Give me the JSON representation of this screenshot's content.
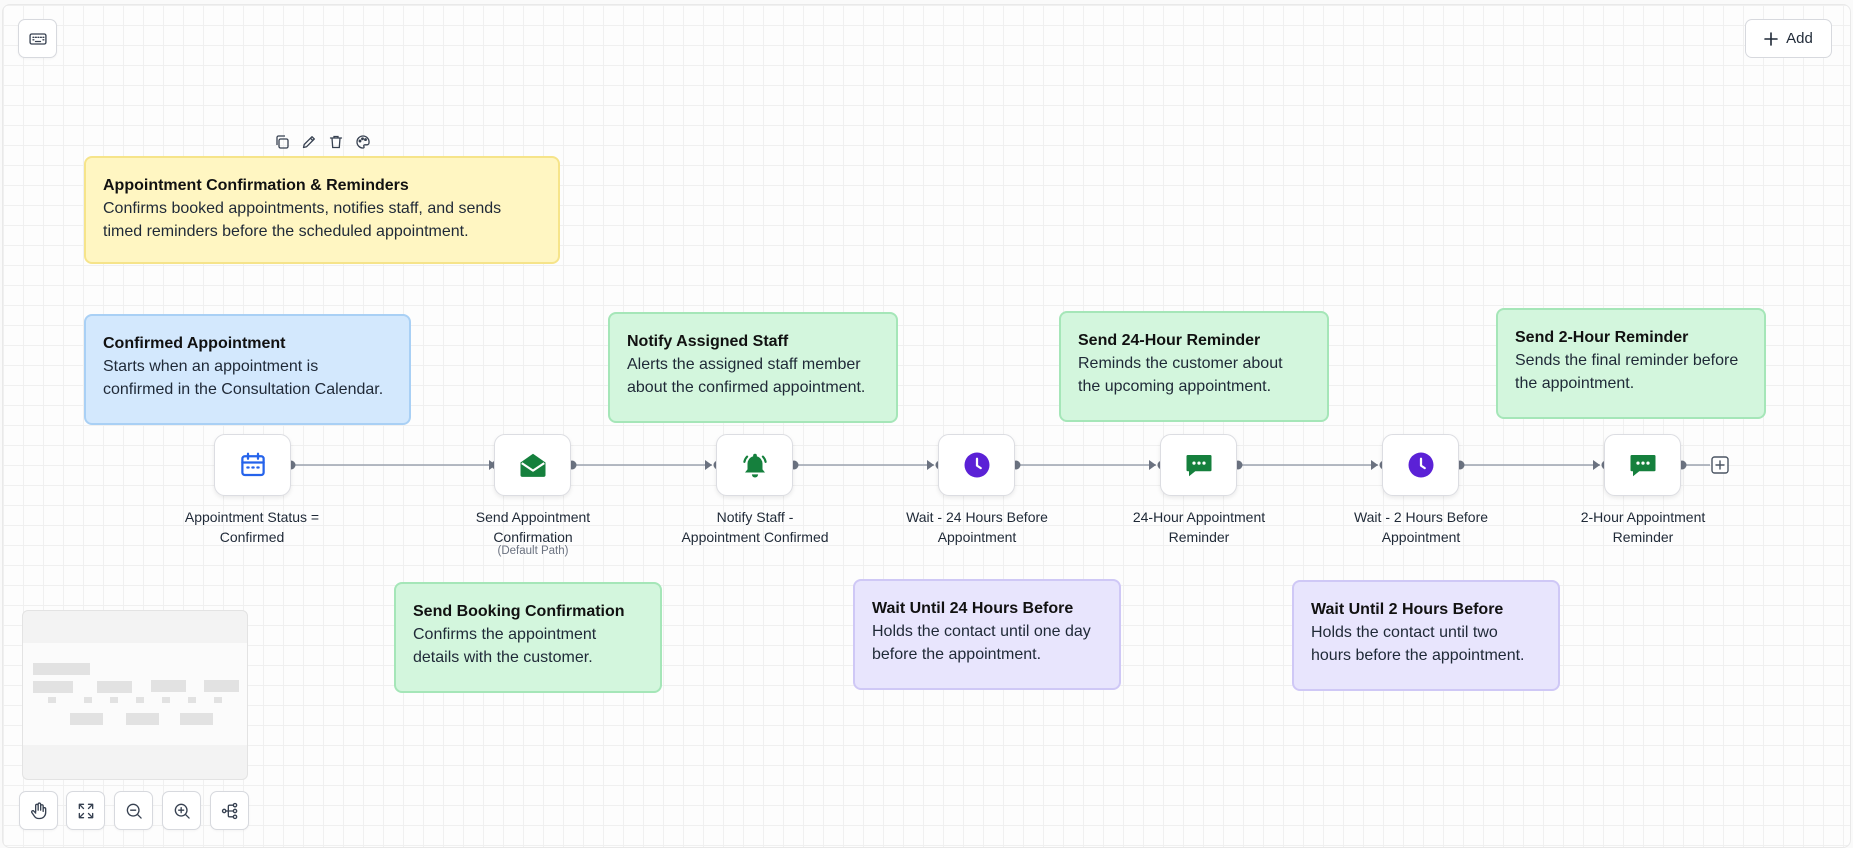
{
  "toolbar": {
    "add_label": "Add"
  },
  "notes": {
    "workflow": {
      "title": "Appointment Confirmation & Reminders",
      "line1": "Confirms booked appointments, notifies staff, and sends",
      "line2": "timed reminders before the scheduled appointment."
    },
    "trigger": {
      "title": "Confirmed Appointment",
      "line1": "Starts when an appointment is",
      "line2": "confirmed in the Consultation Calendar."
    },
    "booking": {
      "title": "Send Booking Confirmation",
      "line1": "Confirms the appointment",
      "line2": "details with the customer."
    },
    "notify": {
      "title": "Notify Assigned Staff",
      "line1": "Alerts the assigned staff member",
      "line2": "about the confirmed appointment."
    },
    "wait24": {
      "title": "Wait Until 24 Hours Before",
      "line1": "Holds the contact until one day",
      "line2": "before the appointment."
    },
    "reminder24": {
      "title": "Send 24-Hour Reminder",
      "line1": "Reminds the customer about",
      "line2": "the upcoming appointment."
    },
    "wait2": {
      "title": "Wait Until 2 Hours Before",
      "line1": "Holds the contact until two",
      "line2": "hours before the appointment."
    },
    "reminder2": {
      "title": "Send 2-Hour Reminder",
      "line1": "Sends the final reminder before",
      "line2": "the appointment."
    }
  },
  "nodes": [
    {
      "line1": "Appointment Status =",
      "line2": "Confirmed",
      "icon": "calendar-icon",
      "color": "#2563eb"
    },
    {
      "line1": "Send Appointment",
      "line2": "Confirmation",
      "sub": "(Default Path)",
      "icon": "email-open-icon",
      "color": "#15803d"
    },
    {
      "line1": "Notify Staff -",
      "line2": "Appointment Confirmed",
      "icon": "bell-icon",
      "color": "#15803d"
    },
    {
      "line1": "Wait - 24 Hours Before",
      "line2": "Appointment",
      "icon": "clock-icon",
      "color": "#5b21d6"
    },
    {
      "line1": "24-Hour Appointment",
      "line2": "Reminder",
      "icon": "sms-icon",
      "color": "#15803d"
    },
    {
      "line1": "Wait - 2 Hours Before",
      "line2": "Appointment",
      "icon": "clock-icon",
      "color": "#5b21d6"
    },
    {
      "line1": "2-Hour Appointment",
      "line2": "Reminder",
      "icon": "sms-icon",
      "color": "#15803d"
    }
  ]
}
